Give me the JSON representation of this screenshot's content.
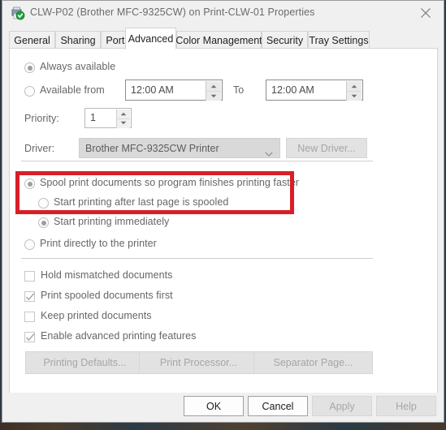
{
  "window": {
    "title": "CLW-P02 (Brother MFC-9325CW) on Print-CLW-01 Properties",
    "icon": "printer-check-icon",
    "close_label": "✕"
  },
  "tabs": [
    {
      "label": "General",
      "selected": false
    },
    {
      "label": "Sharing",
      "selected": false
    },
    {
      "label": "Ports",
      "selected": false
    },
    {
      "label": "Advanced",
      "selected": true
    },
    {
      "label": "Color Management",
      "selected": false
    },
    {
      "label": "Security",
      "selected": false
    },
    {
      "label": "Tray Settings",
      "selected": false
    }
  ],
  "availability": {
    "always_available_label": "Always available",
    "always_available_checked": true,
    "available_from_label": "Available from",
    "available_from_checked": false,
    "from_time": "12:00 AM",
    "to_label": "To",
    "to_time": "12:00 AM"
  },
  "priority": {
    "label": "Priority:",
    "value": "1"
  },
  "driver": {
    "label": "Driver:",
    "value": "Brother MFC-9325CW Printer",
    "new_driver_label": "New Driver...",
    "disabled": true
  },
  "spooling": {
    "spool_label": "Spool print documents so program finishes printing faster",
    "spool_checked": true,
    "after_last_page_label": "Start printing after last page is spooled",
    "after_last_page_checked": false,
    "immediately_label": "Start printing immediately",
    "immediately_checked": true,
    "direct_label": "Print directly to the printer",
    "direct_checked": false
  },
  "options": [
    {
      "label": "Hold mismatched documents",
      "checked": false
    },
    {
      "label": "Print spooled documents first",
      "checked": true
    },
    {
      "label": "Keep printed documents",
      "checked": false
    },
    {
      "label": "Enable advanced printing features",
      "checked": true
    }
  ],
  "action_buttons": [
    {
      "label": "Printing Defaults...",
      "disabled": true
    },
    {
      "label": "Print Processor...",
      "disabled": true
    },
    {
      "label": "Separator Page...",
      "disabled": true
    }
  ],
  "footer_buttons": [
    {
      "label": "OK",
      "disabled": false
    },
    {
      "label": "Cancel",
      "disabled": false
    },
    {
      "label": "Apply",
      "disabled": true
    },
    {
      "label": "Help",
      "disabled": true
    }
  ],
  "annotation": {
    "color": "#d81f26",
    "target": "spool-print-documents-group"
  }
}
